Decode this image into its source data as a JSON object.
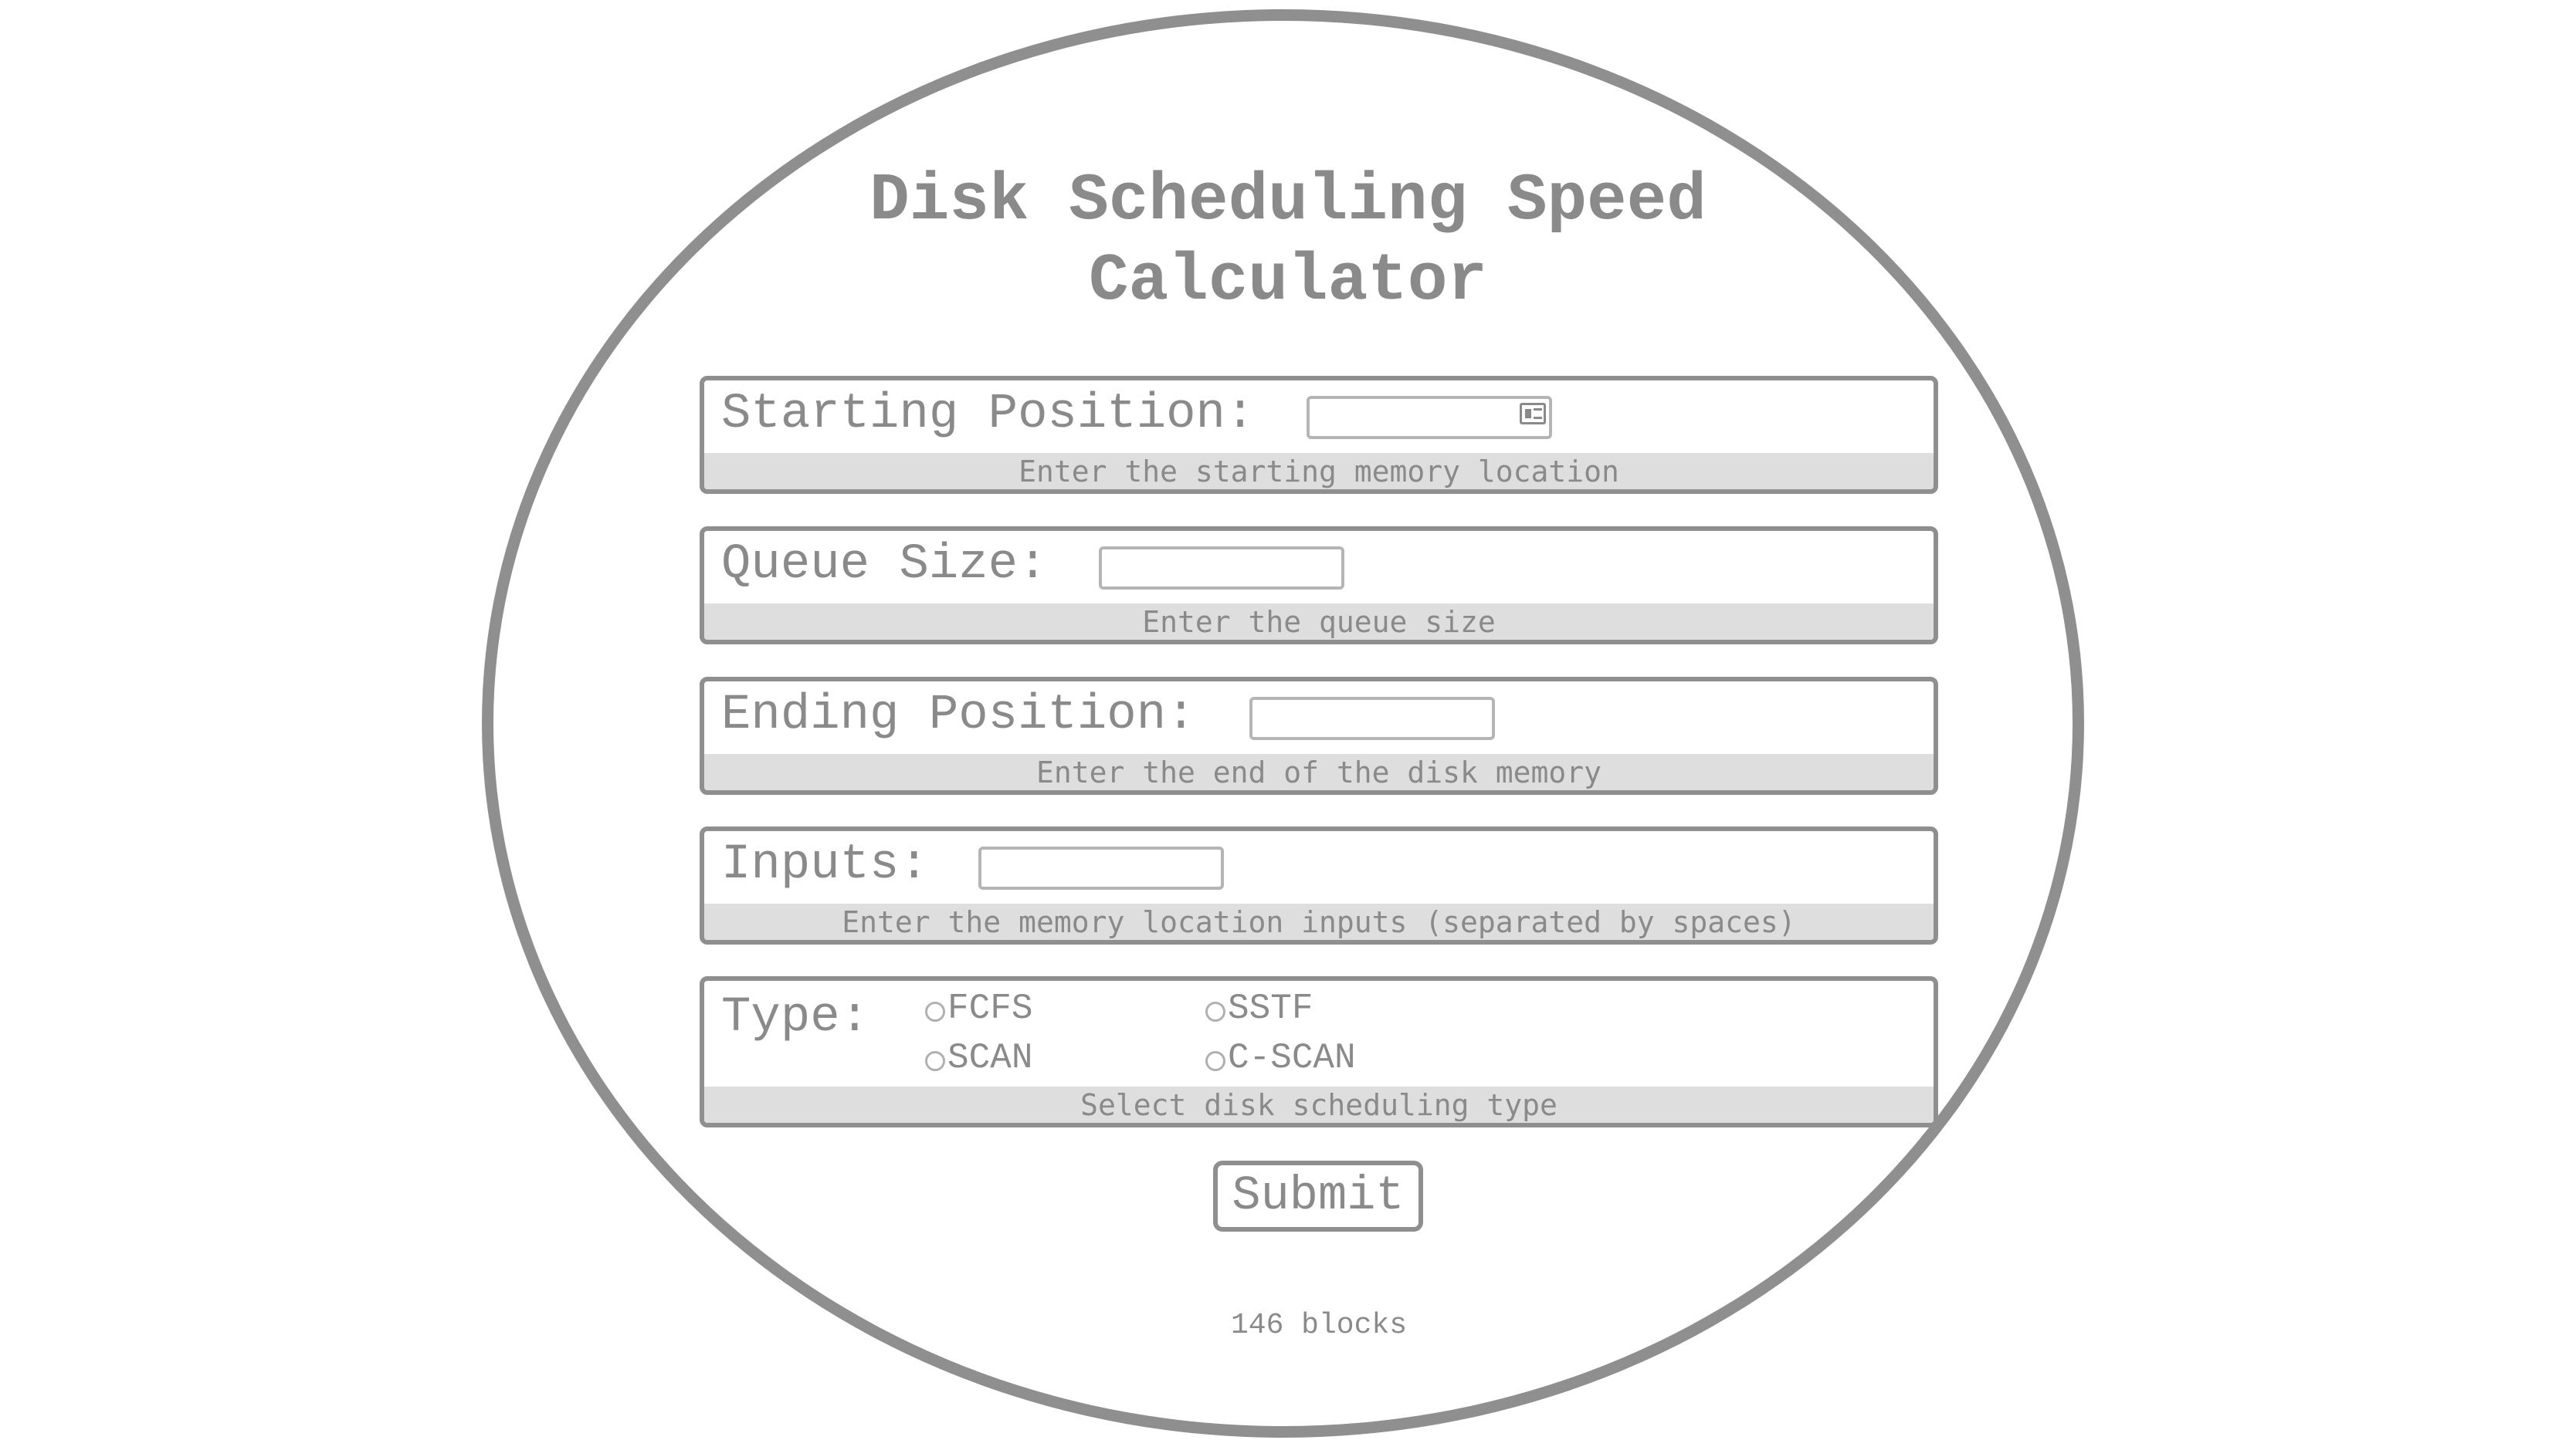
{
  "title": {
    "line1": "Disk Scheduling Speed",
    "line2": "Calculator"
  },
  "fields": {
    "starting": {
      "label": "Starting Position:",
      "value": "",
      "hint": "Enter the starting memory location",
      "icon": "autofill-card-icon"
    },
    "queue": {
      "label": "Queue Size:",
      "value": "",
      "hint": "Enter the queue size"
    },
    "ending": {
      "label": "Ending Position:",
      "value": "",
      "hint": "Enter the end of the disk memory"
    },
    "inputs": {
      "label": "Inputs:",
      "value": "",
      "hint": "Enter the memory location inputs (separated by spaces)"
    }
  },
  "type": {
    "label": "Type:",
    "options": [
      {
        "label": "FCFS",
        "selected": false
      },
      {
        "label": "SSTF",
        "selected": false
      },
      {
        "label": "SCAN",
        "selected": false
      },
      {
        "label": "C-SCAN",
        "selected": false
      }
    ],
    "hint": "Select disk scheduling type"
  },
  "submit_label": "Submit",
  "result": "146 blocks",
  "colors": {
    "foreground": "#8a8a8a",
    "border": "#8f8f8f",
    "hint_background": "#dedede",
    "background": "#ffffff"
  }
}
